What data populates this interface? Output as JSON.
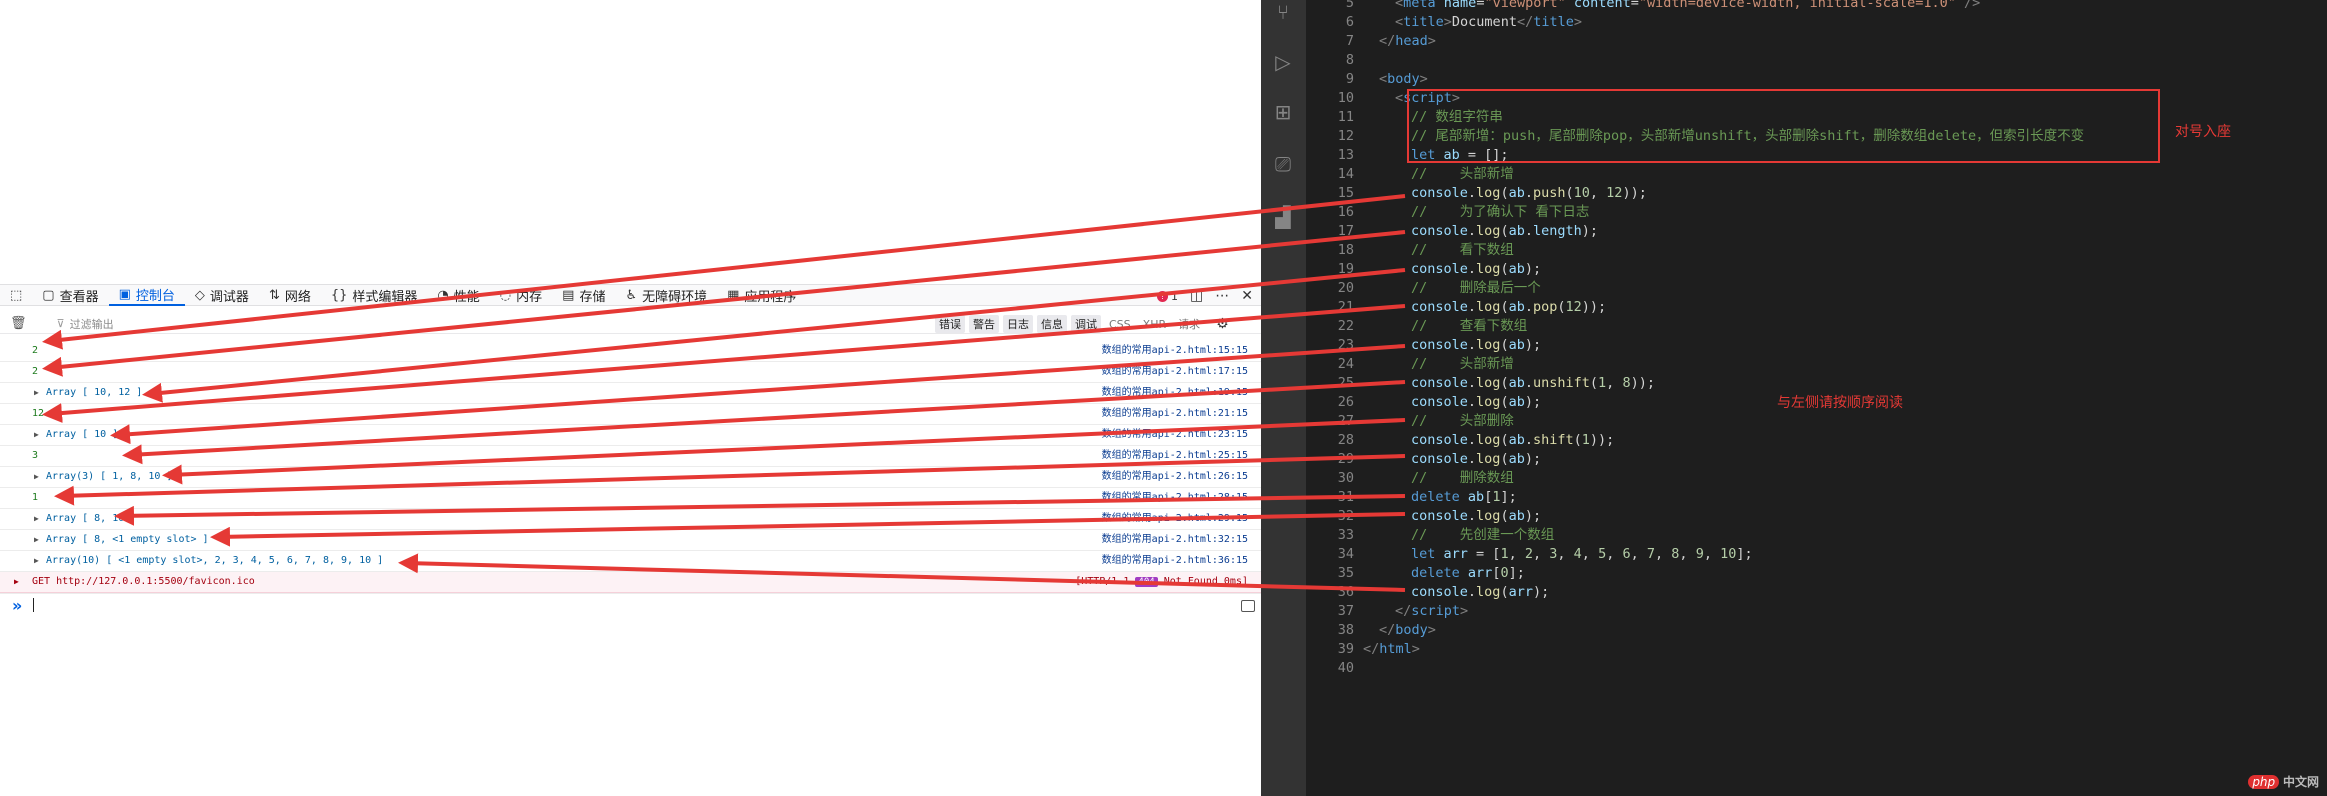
{
  "devtools": {
    "tabs": [
      {
        "icon": "inspector-icon",
        "glyph": "▢",
        "label": "查看器"
      },
      {
        "icon": "console-icon",
        "glyph": "▣",
        "label": "控制台",
        "active": true
      },
      {
        "icon": "debugger-icon",
        "glyph": "◇",
        "label": "调试器"
      },
      {
        "icon": "network-icon",
        "glyph": "⇅",
        "label": "网络"
      },
      {
        "icon": "style-editor-icon",
        "glyph": "{}",
        "label": "样式编辑器"
      },
      {
        "icon": "performance-icon",
        "glyph": "◔",
        "label": "性能"
      },
      {
        "icon": "memory-icon",
        "glyph": "◌",
        "label": "内存"
      },
      {
        "icon": "storage-icon",
        "glyph": "▤",
        "label": "存储"
      },
      {
        "icon": "accessibility-icon",
        "glyph": "♿",
        "label": "无障碍环境"
      },
      {
        "icon": "application-icon",
        "glyph": "▦",
        "label": "应用程序"
      }
    ],
    "error_count": "1",
    "filter_placeholder": "过滤输出",
    "filter_buttons": [
      {
        "label": "错误",
        "on": true
      },
      {
        "label": "警告",
        "on": true
      },
      {
        "label": "日志",
        "on": true
      },
      {
        "label": "信息",
        "on": true
      },
      {
        "label": "调试",
        "on": true
      },
      {
        "label": "CSS",
        "on": false
      },
      {
        "label": "XHR",
        "on": false
      },
      {
        "label": "请求",
        "on": false
      }
    ],
    "console_rows": [
      {
        "kind": "num",
        "text": "2",
        "source": "数组的常用api-2.html:15:15"
      },
      {
        "kind": "num",
        "text": "2",
        "source": "数组的常用api-2.html:17:15"
      },
      {
        "kind": "obj",
        "text": "Array [ 10, 12 ]",
        "source": "数组的常用api-2.html:19:15"
      },
      {
        "kind": "num",
        "text": "12",
        "source": "数组的常用api-2.html:21:15"
      },
      {
        "kind": "obj",
        "text": "Array [ 10 ]",
        "source": "数组的常用api-2.html:23:15"
      },
      {
        "kind": "num",
        "text": "3",
        "source": "数组的常用api-2.html:25:15"
      },
      {
        "kind": "obj",
        "text": "Array(3) [ 1, 8, 10 ]",
        "source": "数组的常用api-2.html:26:15"
      },
      {
        "kind": "num",
        "text": "1",
        "source": "数组的常用api-2.html:28:15"
      },
      {
        "kind": "obj",
        "text": "Array [ 8, 10 ]",
        "source": "数组的常用api-2.html:29:15"
      },
      {
        "kind": "obj",
        "text": "Array [ 8, <1 empty slot> ]",
        "source": "数组的常用api-2.html:32:15"
      },
      {
        "kind": "obj",
        "text": "Array(10) [ <1 empty slot>, 2, 3, 4, 5, 6, 7, 8, 9, 10 ]",
        "source": "数组的常用api-2.html:36:15"
      }
    ],
    "error_row": {
      "text": "GET http://127.0.0.1:5500/favicon.ico",
      "status_prefix": "[HTTP/1.1",
      "status_code": "404",
      "status_suffix": "Not Found 0ms]"
    }
  },
  "editor": {
    "lines": [
      {
        "n": "5",
        "html": "<span class='pun'>&lt;</span><span class='tag'>meta</span> <span class='att'>name</span>=<span class='str'>\"viewport\"</span> <span class='att'>content</span>=<span class='str'>\"width=device-width, initial-scale=1.0\"</span> <span class='pun'>/&gt;</span>",
        "indent": 1
      },
      {
        "n": "6",
        "html": "<span class='pun'>&lt;</span><span class='tag'>title</span><span class='pun'>&gt;</span>Document<span class='pun'>&lt;/</span><span class='tag'>title</span><span class='pun'>&gt;</span>",
        "indent": 1
      },
      {
        "n": "7",
        "html": "<span class='pun'>&lt;/</span><span class='tag'>head</span><span class='pun'>&gt;</span>",
        "indent": 0
      },
      {
        "n": "8",
        "html": "",
        "indent": 0
      },
      {
        "n": "9",
        "html": "<span class='pun'>&lt;</span><span class='tag'>body</span><span class='pun'>&gt;</span>",
        "indent": 0
      },
      {
        "n": "10",
        "html": "<span class='pun'>&lt;</span><span class='tag'>script</span><span class='pun'>&gt;</span>",
        "indent": 1
      },
      {
        "n": "11",
        "html": "<span class='com'>// 数组字符串</span>",
        "indent": 2
      },
      {
        "n": "12",
        "html": "<span class='com'>// 尾部新增：push，尾部删除pop，头部新增unshift，头部删除shift，删除数组delete，但索引长度不变</span>",
        "indent": 2
      },
      {
        "n": "13",
        "html": "<span class='kw'>let</span> <span class='var'>ab</span> = [];",
        "indent": 2
      },
      {
        "n": "14",
        "html": "<span class='com'>//    头部新增</span>",
        "indent": 2
      },
      {
        "n": "15",
        "html": "<span class='var'>console</span>.<span class='fn'>log</span>(<span class='var'>ab</span>.<span class='fn'>push</span>(<span class='num'>10</span>, <span class='num'>12</span>));",
        "indent": 2
      },
      {
        "n": "16",
        "html": "<span class='com'>//    为了确认下 看下日志</span>",
        "indent": 2
      },
      {
        "n": "17",
        "html": "<span class='var'>console</span>.<span class='fn'>log</span>(<span class='var'>ab</span>.<span class='var'>length</span>);",
        "indent": 2
      },
      {
        "n": "18",
        "html": "<span class='com'>//    看下数组</span>",
        "indent": 2
      },
      {
        "n": "19",
        "html": "<span class='var'>console</span>.<span class='fn'>log</span>(<span class='var'>ab</span>);",
        "indent": 2
      },
      {
        "n": "20",
        "html": "<span class='com'>//    删除最后一个</span>",
        "indent": 2
      },
      {
        "n": "21",
        "html": "<span class='var'>console</span>.<span class='fn'>log</span>(<span class='var'>ab</span>.<span class='fn'>pop</span>(<span class='num'>12</span>));",
        "indent": 2
      },
      {
        "n": "22",
        "html": "<span class='com'>//    查看下数组</span>",
        "indent": 2
      },
      {
        "n": "23",
        "html": "<span class='var'>console</span>.<span class='fn'>log</span>(<span class='var'>ab</span>);",
        "indent": 2
      },
      {
        "n": "24",
        "html": "<span class='com'>//    头部新增</span>",
        "indent": 2
      },
      {
        "n": "25",
        "html": "<span class='var'>console</span>.<span class='fn'>log</span>(<span class='var'>ab</span>.<span class='fn'>unshift</span>(<span class='num'>1</span>, <span class='num'>8</span>));",
        "indent": 2
      },
      {
        "n": "26",
        "html": "<span class='var'>console</span>.<span class='fn'>log</span>(<span class='var'>ab</span>);",
        "indent": 2
      },
      {
        "n": "27",
        "html": "<span class='com'>//    头部删除</span>",
        "indent": 2
      },
      {
        "n": "28",
        "html": "<span class='var'>console</span>.<span class='fn'>log</span>(<span class='var'>ab</span>.<span class='fn'>shift</span>(<span class='num'>1</span>));",
        "indent": 2
      },
      {
        "n": "29",
        "html": "<span class='var'>console</span>.<span class='fn'>log</span>(<span class='var'>ab</span>);",
        "indent": 2
      },
      {
        "n": "30",
        "html": "<span class='com'>//    删除数组</span>",
        "indent": 2
      },
      {
        "n": "31",
        "html": "<span class='kw'>delete</span> <span class='var'>ab</span>[<span class='num'>1</span>];",
        "indent": 2
      },
      {
        "n": "32",
        "html": "<span class='var'>console</span>.<span class='fn'>log</span>(<span class='var'>ab</span>);",
        "indent": 2
      },
      {
        "n": "33",
        "html": "<span class='com'>//    先创建一个数组</span>",
        "indent": 2
      },
      {
        "n": "34",
        "html": "<span class='kw'>let</span> <span class='var'>arr</span> = [<span class='num'>1</span>, <span class='num'>2</span>, <span class='num'>3</span>, <span class='num'>4</span>, <span class='num'>5</span>, <span class='num'>6</span>, <span class='num'>7</span>, <span class='num'>8</span>, <span class='num'>9</span>, <span class='num'>10</span>];",
        "indent": 2
      },
      {
        "n": "35",
        "html": "<span class='kw'>delete</span> <span class='var'>arr</span>[<span class='num'>0</span>];",
        "indent": 2
      },
      {
        "n": "36",
        "html": "<span class='var'>console</span>.<span class='fn'>log</span>(<span class='var'>arr</span>);",
        "indent": 2
      },
      {
        "n": "37",
        "html": "<span class='pun'>&lt;/</span><span class='tag'>script</span><span class='pun'>&gt;</span>",
        "indent": 1
      },
      {
        "n": "38",
        "html": "<span class='pun'>&lt;/</span><span class='tag'>body</span><span class='pun'>&gt;</span>",
        "indent": 0
      },
      {
        "n": "39",
        "html": "<span class='pun'>&lt;/</span><span class='tag'>html</span><span class='pun'>&gt;</span>",
        "indent": -1
      },
      {
        "n": "40",
        "html": "",
        "indent": -1
      }
    ],
    "annotation_right": "对号入座",
    "annotation_middle": "与左侧请按顺序阅读"
  },
  "watermark": {
    "brand": "php",
    "text": "中文网"
  },
  "colors": {
    "arrow": "#e53935",
    "accent": "#0060df",
    "editor_bg": "#1e1e1e"
  }
}
